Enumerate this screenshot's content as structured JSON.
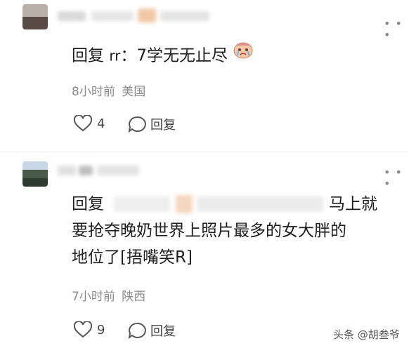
{
  "comments": [
    {
      "reply_prefix": "回复",
      "mention": "rr",
      "body": "：7学无无止尽",
      "emoji": "crying-face",
      "time": "8小时前",
      "location": "美国",
      "likes": "4",
      "reply_label": "回复"
    },
    {
      "reply_prefix": "回复",
      "mention_suffix": "马上就",
      "line2": "要抢夺晚奶世界上照片最多的女大胖的",
      "line3": "地位了[捂嘴笑R]",
      "time": "7小时前",
      "location": "陕西",
      "likes": "9",
      "reply_label": "回复"
    }
  ],
  "more_icon": "more-dots-icon",
  "watermark": "头条 @胡叁爷",
  "colors": {
    "text": "#1f1f1f",
    "meta": "#8a8a8a",
    "heart": "#555555"
  }
}
